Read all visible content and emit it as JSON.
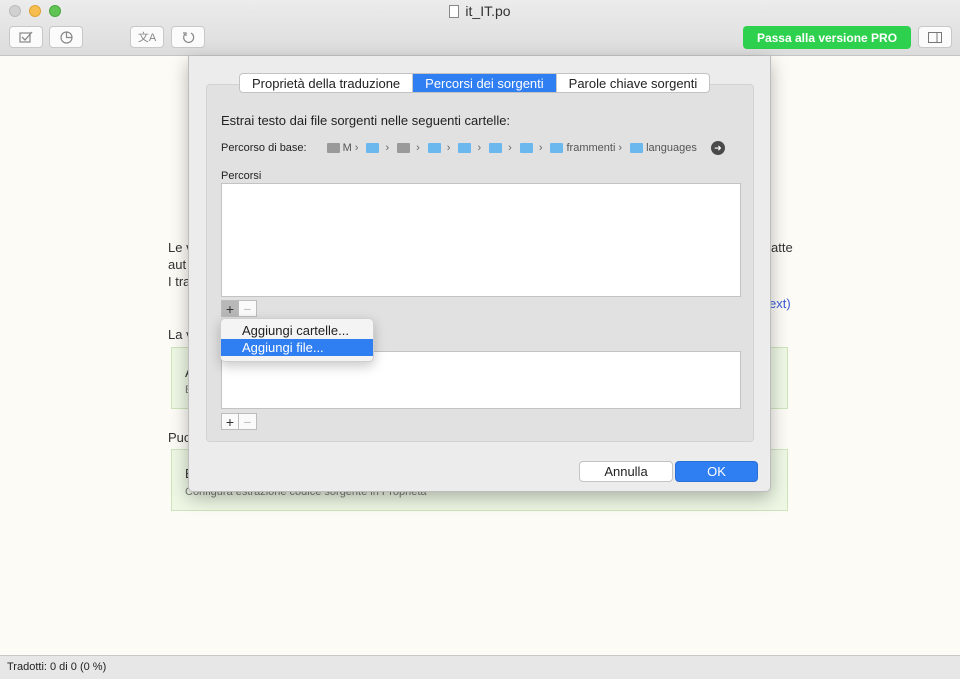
{
  "window": {
    "title": "it_IT.po"
  },
  "toolbar": {
    "pro_label": "Passa alla versione PRO"
  },
  "background": {
    "line1_left": "Le v",
    "line1_right": "atte",
    "line2": "aut",
    "line3": "I tra",
    "link_tail": "ext)",
    "section1": "La v",
    "card1_title": "A",
    "card1_sub": "E",
    "section2": "Puo",
    "card2_title": "E",
    "card2_sub": "Configura estrazione codice sorgente in Proprietà"
  },
  "dialog": {
    "tabs": [
      "Proprietà della traduzione",
      "Percorsi dei sorgenti",
      "Parole chiave sorgenti"
    ],
    "active_tab": 1,
    "heading": "Estrai testo dai file sorgenti nelle seguenti cartelle:",
    "base_path_label": "Percorso di base:",
    "path_segments": [
      "M",
      "",
      "",
      "",
      "",
      "",
      "",
      "frammenti",
      "languages"
    ],
    "paths_label": "Percorsi",
    "add_menu": [
      "Aggiungi cartelle...",
      "Aggiungi file..."
    ],
    "highlighted_menu_item": 1,
    "cancel_label": "Annulla",
    "ok_label": "OK"
  },
  "status": {
    "text": "Tradotti: 0 di 0 (0 %)"
  }
}
